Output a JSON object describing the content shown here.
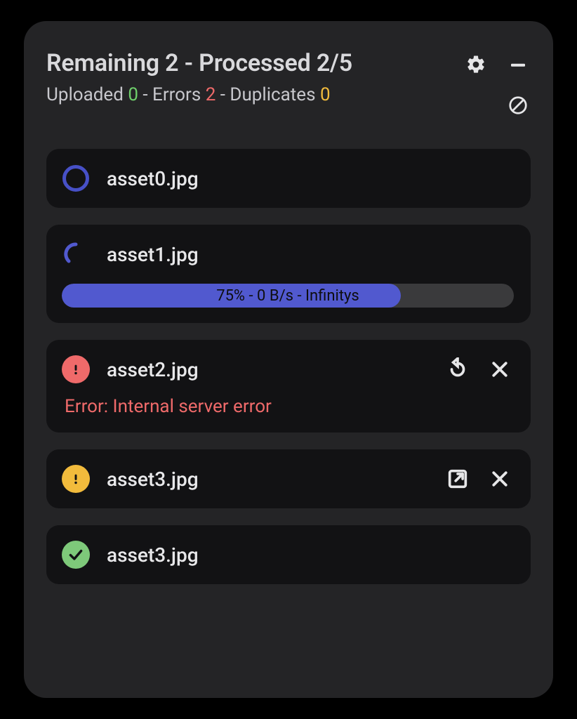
{
  "header": {
    "title": "Remaining 2 - Processed 2/5",
    "sub_prefix_uploaded": "Uploaded ",
    "uploaded": "0",
    "sep1": " - Errors ",
    "errors": "2",
    "sep2": " - Duplicates ",
    "duplicates": "0"
  },
  "items": [
    {
      "file": "asset0.jpg",
      "status": "pending"
    },
    {
      "file": "asset1.jpg",
      "status": "uploading",
      "progress_pct": 75,
      "progress_label": "75% - 0 B/s - Infinitys"
    },
    {
      "file": "asset2.jpg",
      "status": "error",
      "error": "Error: Internal server error"
    },
    {
      "file": "asset3.jpg",
      "status": "duplicate"
    },
    {
      "file": "asset3.jpg",
      "status": "success"
    }
  ],
  "colors": {
    "green": "#6fcf6b",
    "red": "#ef6a6a",
    "yellow": "#f2bb3c",
    "blue": "#5159cf"
  }
}
